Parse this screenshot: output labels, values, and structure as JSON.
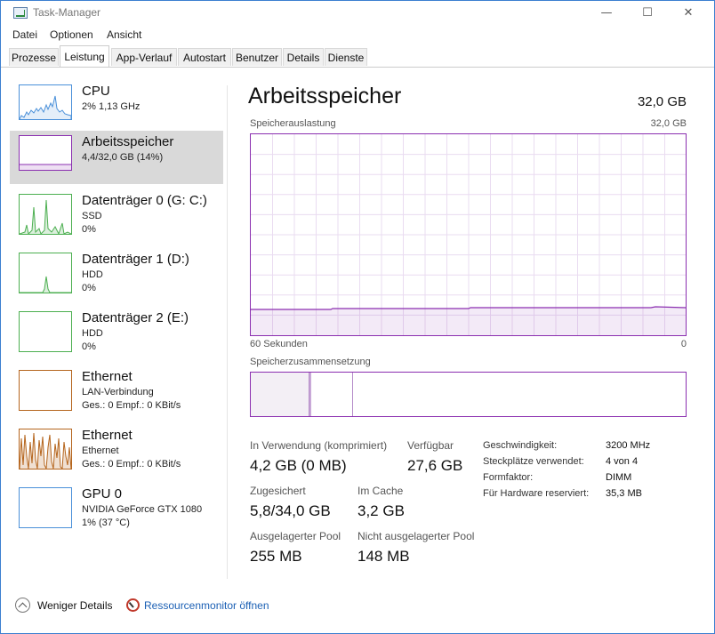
{
  "window": {
    "title": "Task-Manager",
    "minimize": "—",
    "maximize": "☐",
    "close": "✕"
  },
  "menu": [
    "Datei",
    "Optionen",
    "Ansicht"
  ],
  "tabs": [
    "Prozesse",
    "Leistung",
    "App-Verlauf",
    "Autostart",
    "Benutzer",
    "Details",
    "Dienste"
  ],
  "active_tab": "Leistung",
  "colors": {
    "cpu": "#4a90d9",
    "memory": "#8b2fb0",
    "disk": "#4caf50",
    "ethernet": "#b5651d",
    "gpu": "#4a90d9",
    "selected_bg": "#d9d9d9",
    "link": "#1a5fb4"
  },
  "sidebar": {
    "cpu": {
      "title": "CPU",
      "line1": "2% 1,13 GHz",
      "icon": "cpu-graph-icon"
    },
    "memory": {
      "title": "Arbeitsspeicher",
      "line1": "4,4/32,0 GB (14%)",
      "icon": "memory-graph-icon"
    },
    "disk0": {
      "title": "Datenträger 0 (G: C:)",
      "line1": "SSD",
      "line2": "0%",
      "icon": "disk-graph-icon"
    },
    "disk1": {
      "title": "Datenträger 1 (D:)",
      "line1": "HDD",
      "line2": "0%",
      "icon": "disk-graph-icon"
    },
    "disk2": {
      "title": "Datenträger 2 (E:)",
      "line1": "HDD",
      "line2": "0%",
      "icon": "disk-graph-icon"
    },
    "eth1": {
      "title": "Ethernet",
      "line1": "LAN-Verbindung",
      "line2": "Ges.: 0 Empf.: 0 KBit/s",
      "icon": "ethernet-graph-icon"
    },
    "eth2": {
      "title": "Ethernet",
      "line1": "Ethernet",
      "line2": "Ges.: 0 Empf.: 0 KBit/s",
      "icon": "ethernet-graph-icon"
    },
    "gpu": {
      "title": "GPU 0",
      "line1": "NVIDIA GeForce GTX 1080",
      "line2": "1% (37 °C)",
      "icon": "gpu-graph-icon"
    }
  },
  "main": {
    "heading": "Arbeitsspeicher",
    "total": "32,0 GB",
    "usage_graph": {
      "label": "Speicherauslastung",
      "max_label": "32,0 GB",
      "x_left": "60 Sekunden",
      "x_right": "0",
      "usage_fraction": 0.14
    },
    "composition": {
      "label": "Speicherzusammensetzung"
    },
    "stats": {
      "in_use_label": "In Verwendung (komprimiert)",
      "in_use_value": "4,2 GB (0 MB)",
      "available_label": "Verfügbar",
      "available_value": "27,6 GB",
      "committed_label": "Zugesichert",
      "committed_value": "5,8/34,0 GB",
      "cached_label": "Im Cache",
      "cached_value": "3,2 GB",
      "paged_label": "Ausgelagerter Pool",
      "paged_value": "255 MB",
      "nonpaged_label": "Nicht ausgelagerter Pool",
      "nonpaged_value": "148 MB"
    },
    "specs": {
      "speed_label": "Geschwindigkeit:",
      "speed_value": "3200 MHz",
      "slots_label": "Steckplätze verwendet:",
      "slots_value": "4 von 4",
      "form_label": "Formfaktor:",
      "form_value": "DIMM",
      "reserved_label": "Für Hardware reserviert:",
      "reserved_value": "35,3 MB"
    }
  },
  "footer": {
    "less_details": "Weniger Details",
    "resmon": "Ressourcenmonitor öffnen"
  }
}
